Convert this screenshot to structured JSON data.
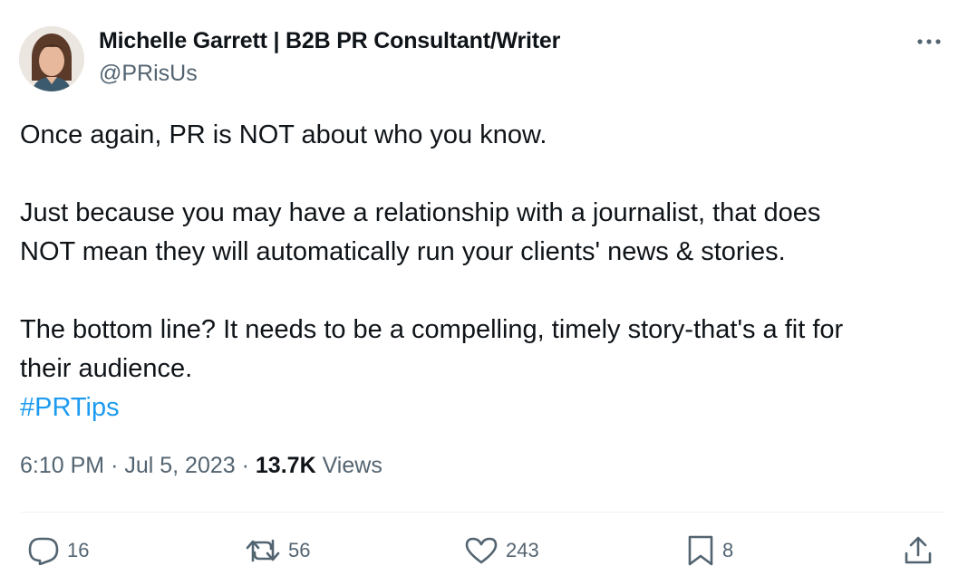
{
  "author": {
    "name": "Michelle Garrett | B2B PR Consultant/Writer",
    "handle": "@PRisUs"
  },
  "tweet": {
    "lines": [
      "Once again, PR is NOT about who you know.",
      "Just because you may have a relationship with a journalist, that does",
      "NOT mean they will automatically run your clients' news & stories.",
      "The bottom line? It needs to be a compelling, timely story-that's a fit for",
      "their audience."
    ],
    "hashtag": "#PRTips"
  },
  "meta": {
    "time": "6:10 PM",
    "separator": "·",
    "date": "Jul 5, 2023",
    "views_count": "13.7K",
    "views_label": "Views"
  },
  "actions": {
    "replies": "16",
    "retweets": "56",
    "likes": "243",
    "bookmarks": "8"
  },
  "icons": {
    "more": "more-horizontal-icon",
    "reply": "reply-icon",
    "retweet": "retweet-icon",
    "like": "heart-icon",
    "bookmark": "bookmark-icon",
    "share": "share-icon"
  },
  "colors": {
    "text": "#0f1419",
    "secondary": "#536471",
    "link": "#1d9bf0",
    "divider": "#eff3f4"
  }
}
